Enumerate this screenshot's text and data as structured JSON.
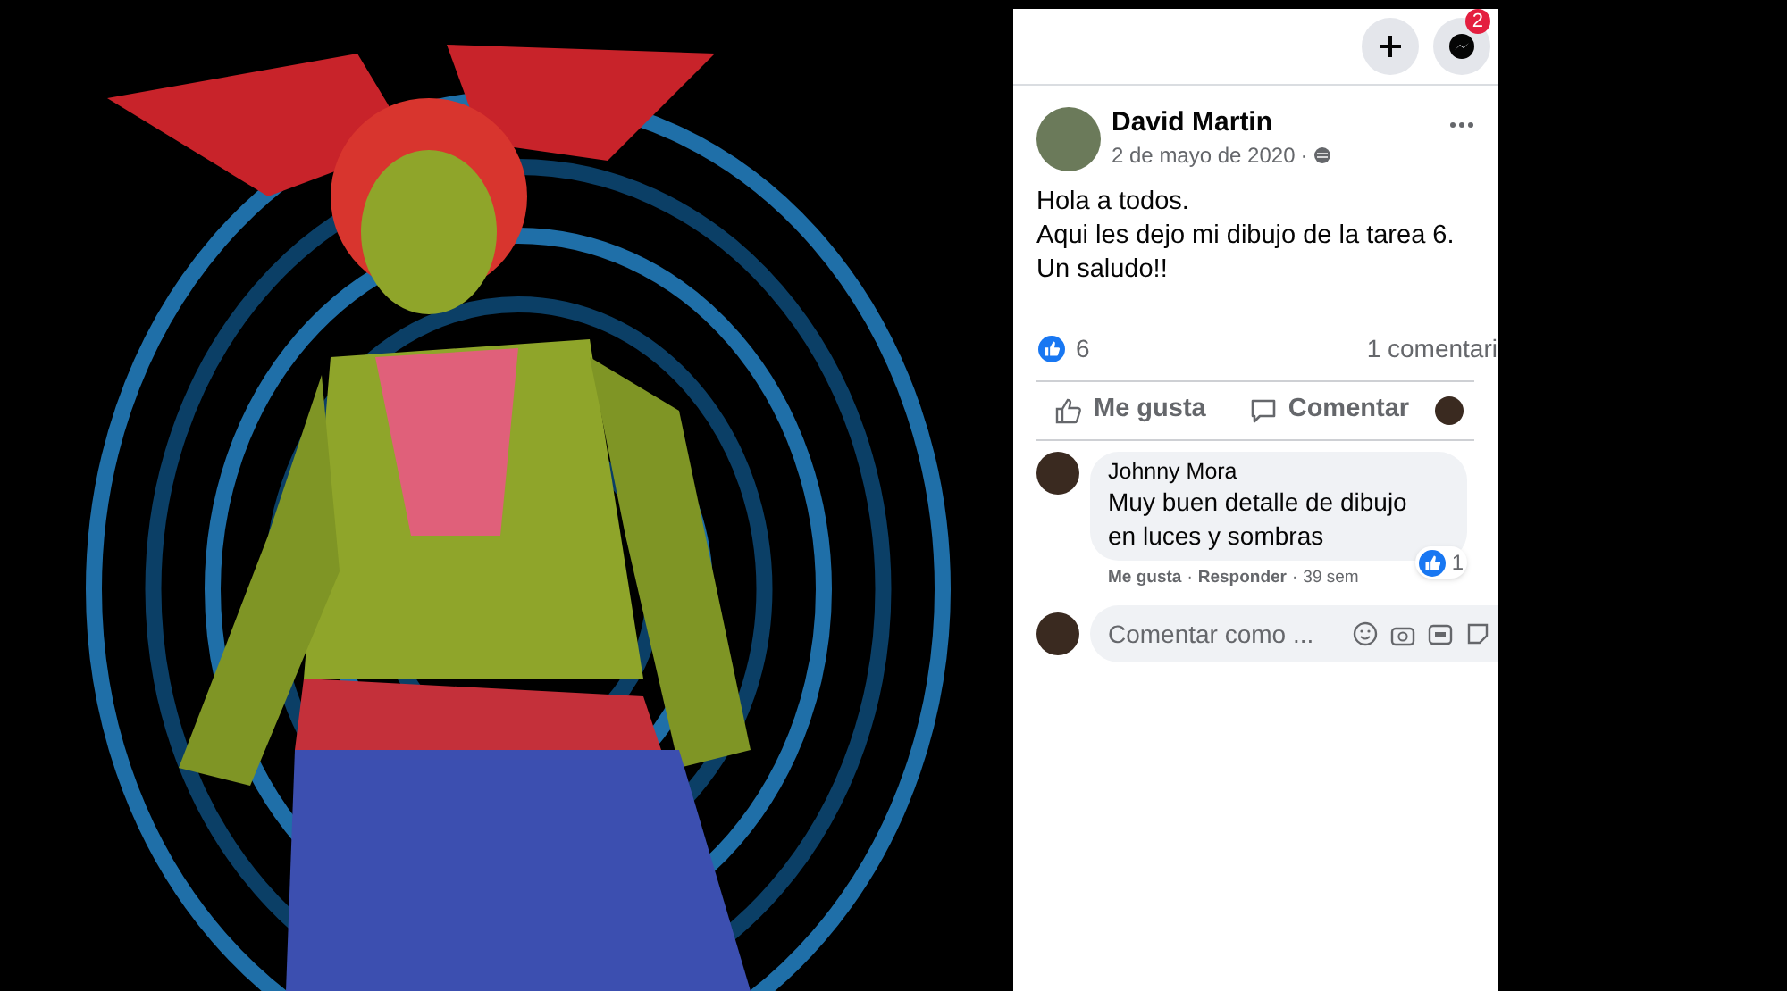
{
  "top_bar": {
    "messenger_badge": "2"
  },
  "post": {
    "author": "David Martin",
    "date": "2 de mayo de 2020",
    "date_separator": "·",
    "text_lines": [
      "Hola a todos.",
      "Aqui les dejo mi dibujo de la tarea 6.",
      "Un saludo!!"
    ],
    "reactions_count": "6",
    "comments_count": "1 comentari"
  },
  "actions": [
    {
      "kind": "like",
      "label": "Me gusta"
    },
    {
      "kind": "comment",
      "label": "Comentar"
    }
  ],
  "comments": [
    {
      "author": "Johnny Mora",
      "text": "Muy buen detalle de dibujo en luces y sombras",
      "like": "Me gusta",
      "separators": [
        "·",
        "·"
      ],
      "reply": "Responder",
      "time": "39 sem",
      "reactions": "1"
    }
  ],
  "comment_field": {
    "placeholder": "Comentar como ..."
  }
}
